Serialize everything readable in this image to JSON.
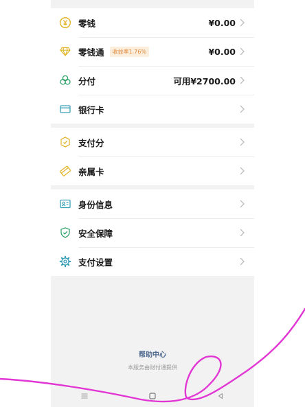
{
  "colors": {
    "accent_yellow": "#e3b62e",
    "accent_green": "#2ea169",
    "icon_blue": "#3aa0b8",
    "badge_text": "#e0893b",
    "badge_bg": "#fbeedd",
    "link_blue": "#4f6a8f",
    "scribble": "#e236d4"
  },
  "menu_groups": [
    {
      "items": [
        {
          "label": "零钱",
          "value": "¥0.00",
          "icon": "yuan-coin-icon"
        },
        {
          "label": "零钱通",
          "badge": "收益率1.76%",
          "value": "¥0.00",
          "icon": "diamond-icon"
        },
        {
          "label": "分付",
          "value": "可用¥2700.00",
          "icon": "fenfu-clover-icon"
        },
        {
          "label": "银行卡",
          "icon": "bank-card-icon"
        }
      ]
    },
    {
      "items": [
        {
          "label": "支付分",
          "icon": "pay-score-badge-icon"
        },
        {
          "label": "亲属卡",
          "icon": "family-card-icon"
        }
      ]
    },
    {
      "items": [
        {
          "label": "身份信息",
          "icon": "id-card-icon"
        },
        {
          "label": "安全保障",
          "icon": "shield-check-icon"
        },
        {
          "label": "支付设置",
          "icon": "gear-icon"
        }
      ]
    }
  ],
  "footer": {
    "help_center": "帮助中心",
    "provider_note": "本服务由财付通提供"
  },
  "nav_bar": {
    "buttons": [
      {
        "icon": "menu-lines-icon"
      },
      {
        "icon": "home-square-icon"
      },
      {
        "icon": "back-triangle-icon"
      }
    ]
  }
}
